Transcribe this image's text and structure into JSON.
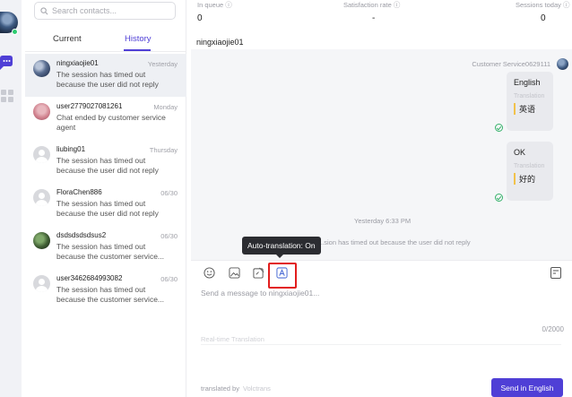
{
  "rail": {
    "avatar": "user-avatar",
    "status_color": "#2ecc71",
    "icons": [
      "chat-bubble-icon",
      "apps-grid-icon"
    ]
  },
  "search": {
    "placeholder": "Search contacts...",
    "icon": "search-icon"
  },
  "tabs": [
    {
      "label": "Current",
      "active": false
    },
    {
      "label": "History",
      "active": true
    }
  ],
  "contacts": [
    {
      "name": "ningxiaojie01",
      "time": "Yesterday",
      "preview": "The session has timed out because the user did not reply"
    },
    {
      "name": "user2779027081261",
      "time": "Monday",
      "preview": "Chat ended by customer service agent"
    },
    {
      "name": "liubing01",
      "time": "Thursday",
      "preview": "The session has timed out because the user did not reply"
    },
    {
      "name": "FloraChen886",
      "time": "06/30",
      "preview": "The session has timed out because the user did not reply"
    },
    {
      "name": "dsdsdsdsdsus2",
      "time": "06/30",
      "preview": "The session has timed out because the customer service..."
    },
    {
      "name": "user3462684993082",
      "time": "06/30",
      "preview": "The session has timed out because the customer service..."
    }
  ],
  "stats": {
    "in_queue": {
      "label": "In queue",
      "value": "0"
    },
    "satisfaction": {
      "label": "Satisfaction rate",
      "value": "-"
    },
    "sessions_today": {
      "label": "Sessions today",
      "value": "0"
    }
  },
  "chat": {
    "title": "ningxiaojie01",
    "agent_label": "Customer Service0629111",
    "messages": [
      {
        "original": "English",
        "translation_label": "Translation",
        "translated": "英语"
      },
      {
        "original": "OK",
        "translation_label": "Translation",
        "translated": "好的"
      }
    ],
    "system_time": "Yesterday 6:33 PM",
    "system_message": "...sion has timed out because the user did not reply"
  },
  "tooltip": "Auto-translation: On",
  "composer": {
    "tools": [
      "emoji-icon",
      "image-icon",
      "quick-reply-icon",
      "translate-icon"
    ],
    "side_tool": "history-panel-icon",
    "placeholder": "Send a message to ningxiaojie01...",
    "counter": "0/2000",
    "realtime_label": "Real-time Translation",
    "powered_by": "translated by",
    "brand": "Volctrans",
    "send_label": "Send in English",
    "accent": "#4f3fd6",
    "highlight": "#e21d1d"
  }
}
